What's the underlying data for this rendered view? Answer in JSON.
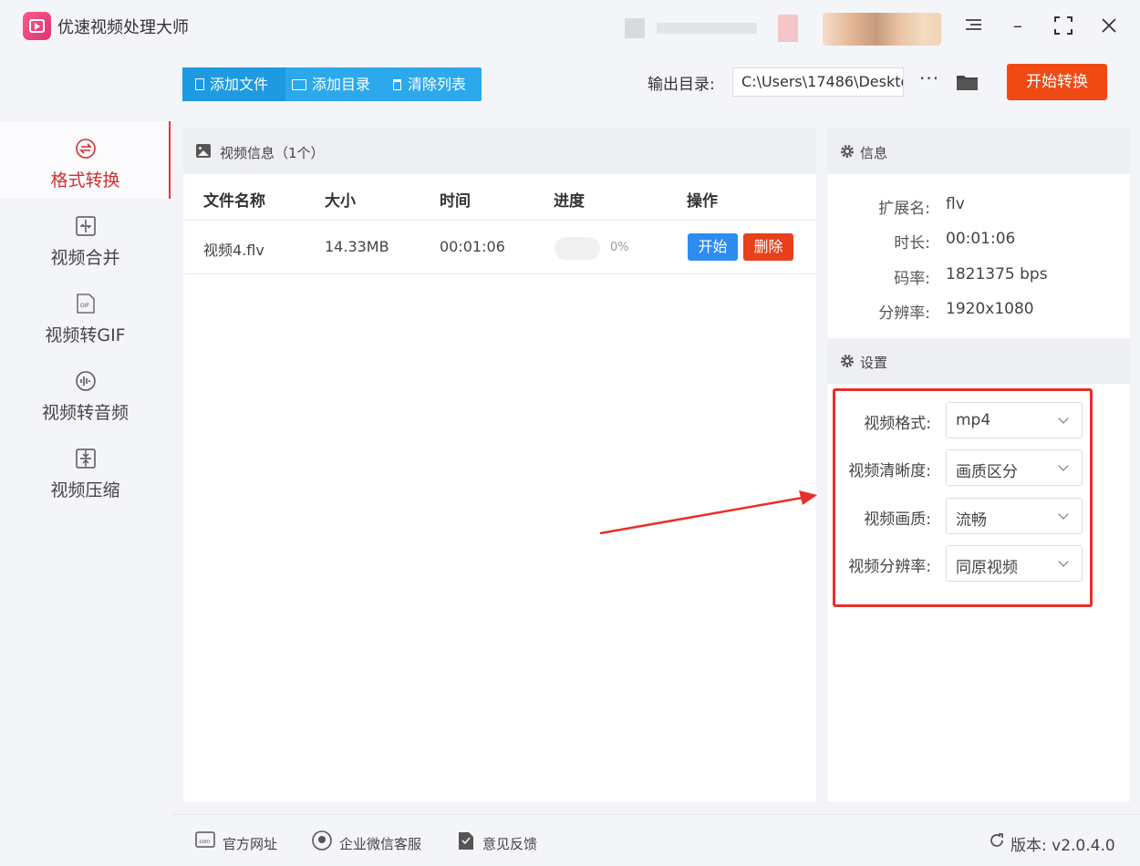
{
  "app": {
    "title": "优速视频处理大师"
  },
  "sidebar": {
    "items": [
      {
        "label": "格式转换",
        "icon": "format-convert-icon"
      },
      {
        "label": "视频合并",
        "icon": "merge-icon"
      },
      {
        "label": "视频转GIF",
        "icon": "gif-icon"
      },
      {
        "label": "视频转音频",
        "icon": "audio-icon"
      },
      {
        "label": "视频压缩",
        "icon": "compress-icon"
      }
    ]
  },
  "toolbar": {
    "add_file": "添加文件",
    "add_dir": "添加目录",
    "clear_list": "清除列表",
    "output_label": "输出目录:",
    "output_path": "C:\\Users\\17486\\Deskto",
    "more": "···",
    "start_convert": "开始转换"
  },
  "file_panel": {
    "title": "视频信息（1个）",
    "headers": [
      "文件名称",
      "大小",
      "时间",
      "进度",
      "操作"
    ],
    "rows": [
      {
        "name": "视频4.flv",
        "size": "14.33MB",
        "time": "00:01:06",
        "progress": 0,
        "progress_text": "0%",
        "start": "开始",
        "delete": "删除"
      }
    ]
  },
  "info": {
    "title": "信息",
    "fields": [
      {
        "key": "扩展名:",
        "value": "flv"
      },
      {
        "key": "时长:",
        "value": "00:01:06"
      },
      {
        "key": "码率:",
        "value": "1821375 bps"
      },
      {
        "key": "分辨率:",
        "value": "1920x1080"
      }
    ]
  },
  "settings": {
    "title": "设置",
    "fields": [
      {
        "key": "视频格式:",
        "value": "mp4"
      },
      {
        "key": "视频清晰度:",
        "value": "画质区分"
      },
      {
        "key": "视频画质:",
        "value": "流畅"
      },
      {
        "key": "视频分辨率:",
        "value": "同原视频"
      }
    ]
  },
  "footer": {
    "website": "官方网址",
    "wechat": "企业微信客服",
    "feedback": "意见反馈",
    "version": "版本: v2.0.4.0"
  },
  "colors": {
    "accent": "#2ca8ec",
    "danger": "#f04a14",
    "active_nav": "#d32f2f",
    "highlight": "#e8302a"
  }
}
